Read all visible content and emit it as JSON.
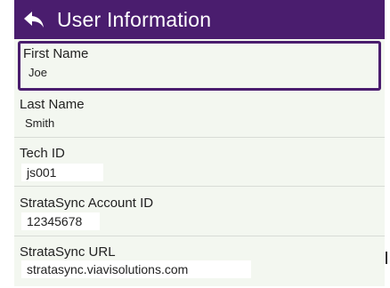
{
  "header": {
    "title": "User Information",
    "back_icon": "back-arrow-icon",
    "background_color": "#4a1d6e"
  },
  "fields": [
    {
      "label": "First Name",
      "value": "Joe"
    },
    {
      "label": "Last Name",
      "value": "Smith"
    },
    {
      "label": "Tech ID",
      "value": "js001"
    },
    {
      "label": "StrataSync Account ID",
      "value": "12345678"
    },
    {
      "label": "StrataSync URL",
      "value": "stratasync.viavisolutions.com"
    }
  ],
  "colors": {
    "accent": "#4a1d6e",
    "list_background": "#f3f7f0",
    "divider": "#d8dcd6"
  }
}
